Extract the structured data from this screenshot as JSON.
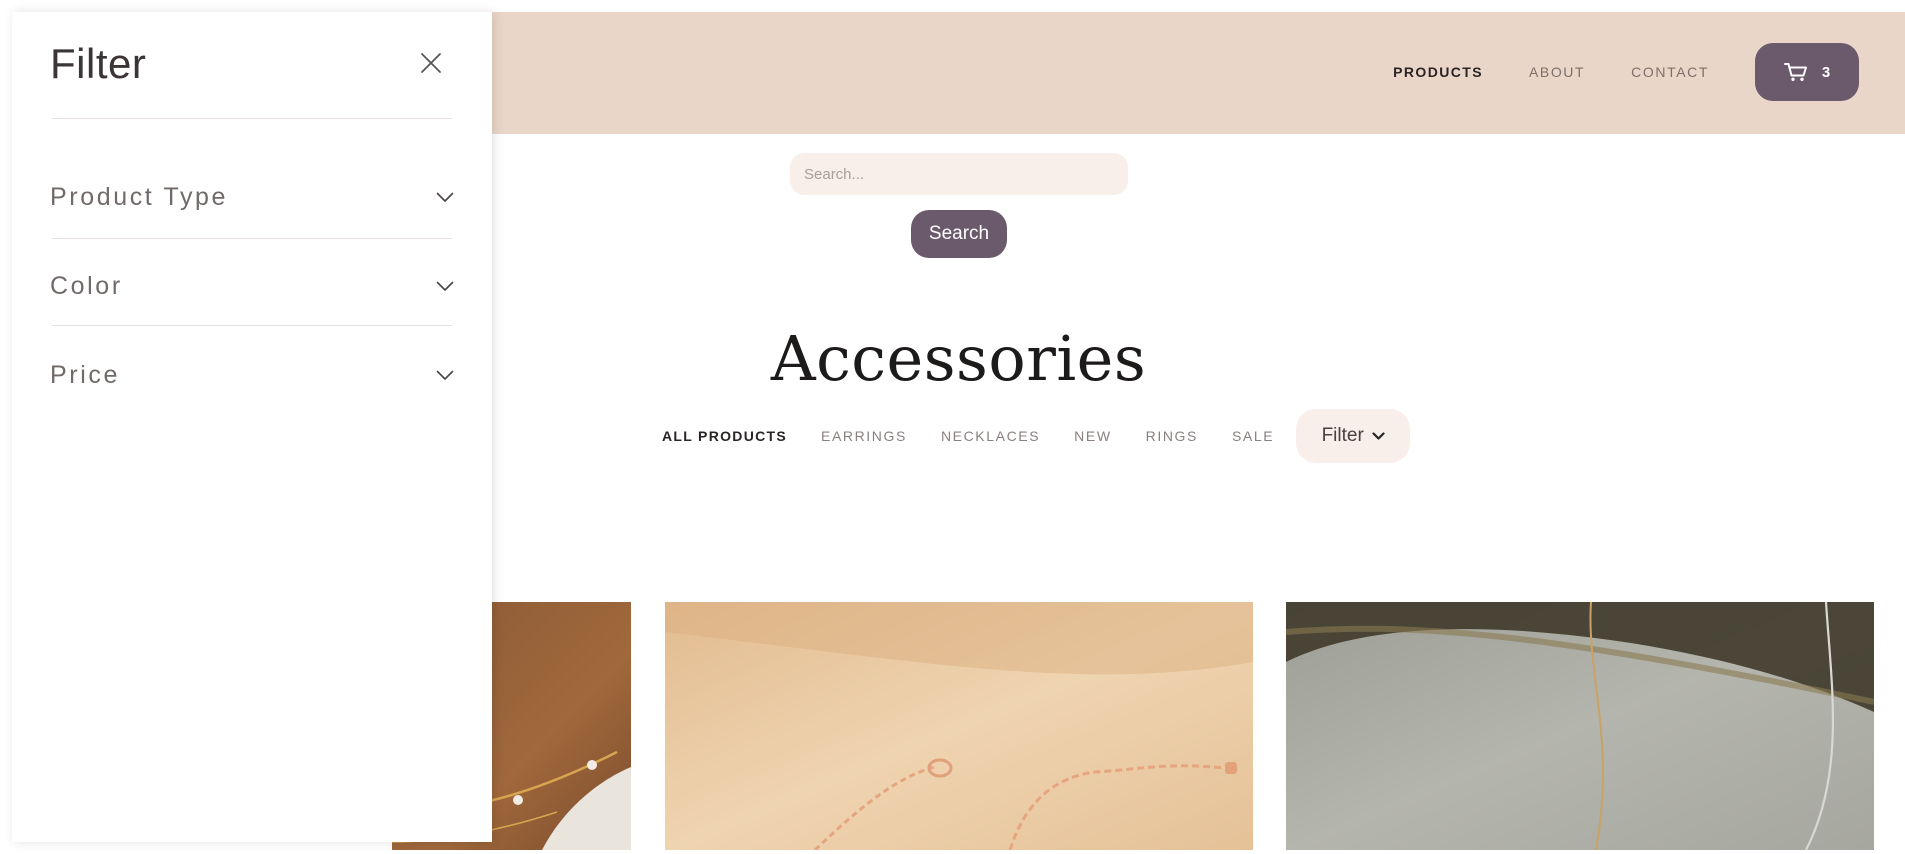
{
  "nav": {
    "links": [
      {
        "label": "PRODUCTS",
        "active": true
      },
      {
        "label": "ABOUT",
        "active": false
      },
      {
        "label": "CONTACT",
        "active": false
      }
    ],
    "cart": {
      "icon": "cart-icon",
      "count": "3"
    }
  },
  "search": {
    "placeholder": "Search...",
    "value": "",
    "button_label": "Search"
  },
  "page": {
    "title": "Accessories"
  },
  "categories": [
    {
      "label": "ALL PRODUCTS",
      "active": true
    },
    {
      "label": "EARRINGS",
      "active": false
    },
    {
      "label": "NECKLACES",
      "active": false
    },
    {
      "label": "NEW",
      "active": false
    },
    {
      "label": "RINGS",
      "active": false
    },
    {
      "label": "SALE",
      "active": false
    }
  ],
  "filter_button": {
    "label": "Filter",
    "icon": "chevron-down-icon"
  },
  "drawer": {
    "title": "Filter",
    "close_icon": "close-icon",
    "sections": [
      {
        "label": "Product Type",
        "icon": "chevron-down-icon"
      },
      {
        "label": "Color",
        "icon": "chevron-down-icon"
      },
      {
        "label": "Price",
        "icon": "chevron-down-icon"
      }
    ]
  },
  "colors": {
    "header_bg": "#ead6c8",
    "accent": "#6b5a6b",
    "soft_bg": "#f8efea"
  }
}
